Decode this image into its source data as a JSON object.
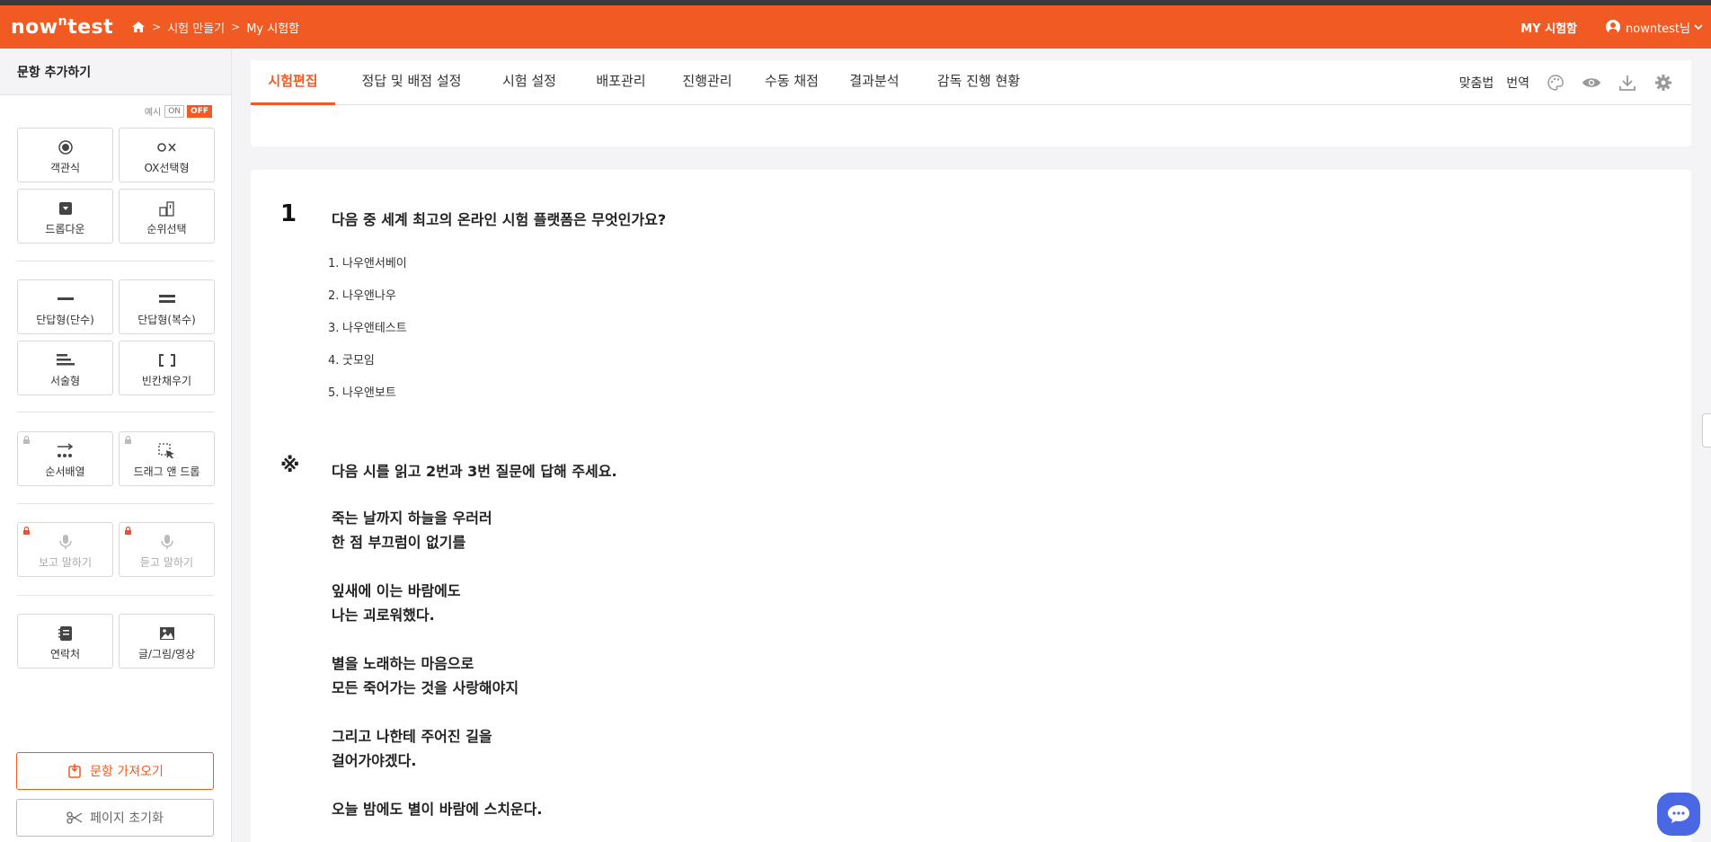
{
  "app": {
    "logo_main": "now",
    "logo_sup": "n",
    "logo_tail": "test",
    "brand_color": "#f15a22"
  },
  "breadcrumb": {
    "items": [
      "시험 만들기",
      "My 시험함"
    ]
  },
  "header": {
    "my_tests": "MY 시험함",
    "user_name": "nowntest님"
  },
  "sidebar": {
    "title": "문항 추가하기",
    "example_label": "예시",
    "toggle_on": "ON",
    "toggle_off": "OFF",
    "tiles": {
      "multiple_choice": "객관식",
      "ox": "OX선택형",
      "dropdown": "드롭다운",
      "ranking": "순위선택",
      "short_single": "단답형(단수)",
      "short_multi": "단답형(복수)",
      "essay": "서술형",
      "fill_blank": "빈칸채우기",
      "ordering": "순서배열",
      "drag_drop": "드래그 앤 드롭",
      "see_speak": "보고 말하기",
      "listen_speak": "듣고 말하기",
      "contacts": "연락처",
      "media": "글/그림/영상"
    },
    "import_button": "문항 가져오기",
    "reset_button": "페이지 초기화"
  },
  "tabs": [
    "시험편집",
    "정답 및 배점 설정",
    "시험 설정",
    "배포관리",
    "진행관리",
    "수동 채점",
    "결과분석",
    "감독 진행 현황"
  ],
  "tools": {
    "spell": "맞춤법",
    "translate": "번역"
  },
  "question1": {
    "number": "1",
    "text": "다음 중 세계 최고의 온라인 시험 플랫폼은 무엇인가요?",
    "options": [
      {
        "n": "1.",
        "label": "나우앤서베이"
      },
      {
        "n": "2.",
        "label": "나우앤나우"
      },
      {
        "n": "3.",
        "label": "나우앤테스트"
      },
      {
        "n": "4.",
        "label": "굿모임"
      },
      {
        "n": "5.",
        "label": "나우앤보트"
      }
    ]
  },
  "passage": {
    "mark": "※",
    "title": "다음 시를 읽고 2번과 3번 질문에 답해 주세요.",
    "lines": [
      "죽는 날까지 하늘을 우러러",
      "한 점 부끄럼이 없기를",
      "잎새에 이는 바람에도",
      "나는 괴로워했다.",
      "별을 노래하는 마음으로",
      "모든 죽어가는 것을 사랑해야지",
      "그리고 나한테 주어진 길을",
      "걸어가야겠다.",
      "오늘 밤에도 별이 바람에 스치운다."
    ]
  }
}
